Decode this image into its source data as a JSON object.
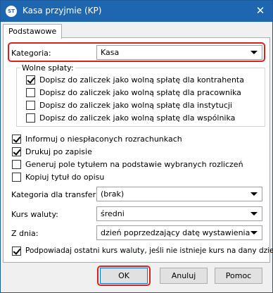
{
  "window": {
    "title": "Kasa przyjmie (KP)",
    "icon": "ST",
    "close_glyph": "✕"
  },
  "tabs": [
    {
      "label": "Podstawowe"
    }
  ],
  "kategoria": {
    "label": "Kategoria:",
    "value": "Kasa"
  },
  "wolne_splaty": {
    "legend": "Wolne spłaty:",
    "items": [
      {
        "label": "Dopisz do zaliczek jako wolną spłatę dla kontrahenta",
        "checked": true
      },
      {
        "label": "Dopisz do zaliczek jako wolną spłatę dla pracownika",
        "checked": false
      },
      {
        "label": "Dopisz do zaliczek jako wolną spłatę dla instytucji",
        "checked": false
      },
      {
        "label": "Dopisz do zaliczek jako wolną spłatę dla wspólnika",
        "checked": false
      }
    ]
  },
  "options": [
    {
      "label": "Informuj o niespłaconych rozrachunkach",
      "checked": true
    },
    {
      "label": "Drukuj po zapisie",
      "checked": true
    },
    {
      "label": "Generuj pole tytułem na podstawie wybranych rozliczeń",
      "checked": false
    },
    {
      "label": "Kopiuj tytuł do opisu",
      "checked": false
    }
  ],
  "kategoria_transfer": {
    "label": "Kategoria dla transferu:",
    "value": "(brak)"
  },
  "kurs_waluty": {
    "label": "Kurs waluty:",
    "value": "średni"
  },
  "z_dnia": {
    "label": "Z dnia:",
    "value": "dzień poprzedzający datę wystawienia"
  },
  "podpowiadaj": {
    "label": "Podpowiadaj ostatni kurs waluty, jeśli nie istnieje kurs na dany dzień",
    "checked": true
  },
  "buttons": {
    "ok": "OK",
    "anuluj": "Anuluj",
    "pomoc": "Pomoc"
  },
  "colors": {
    "titlebar": "#1e66b0",
    "highlight": "#d9211e"
  }
}
